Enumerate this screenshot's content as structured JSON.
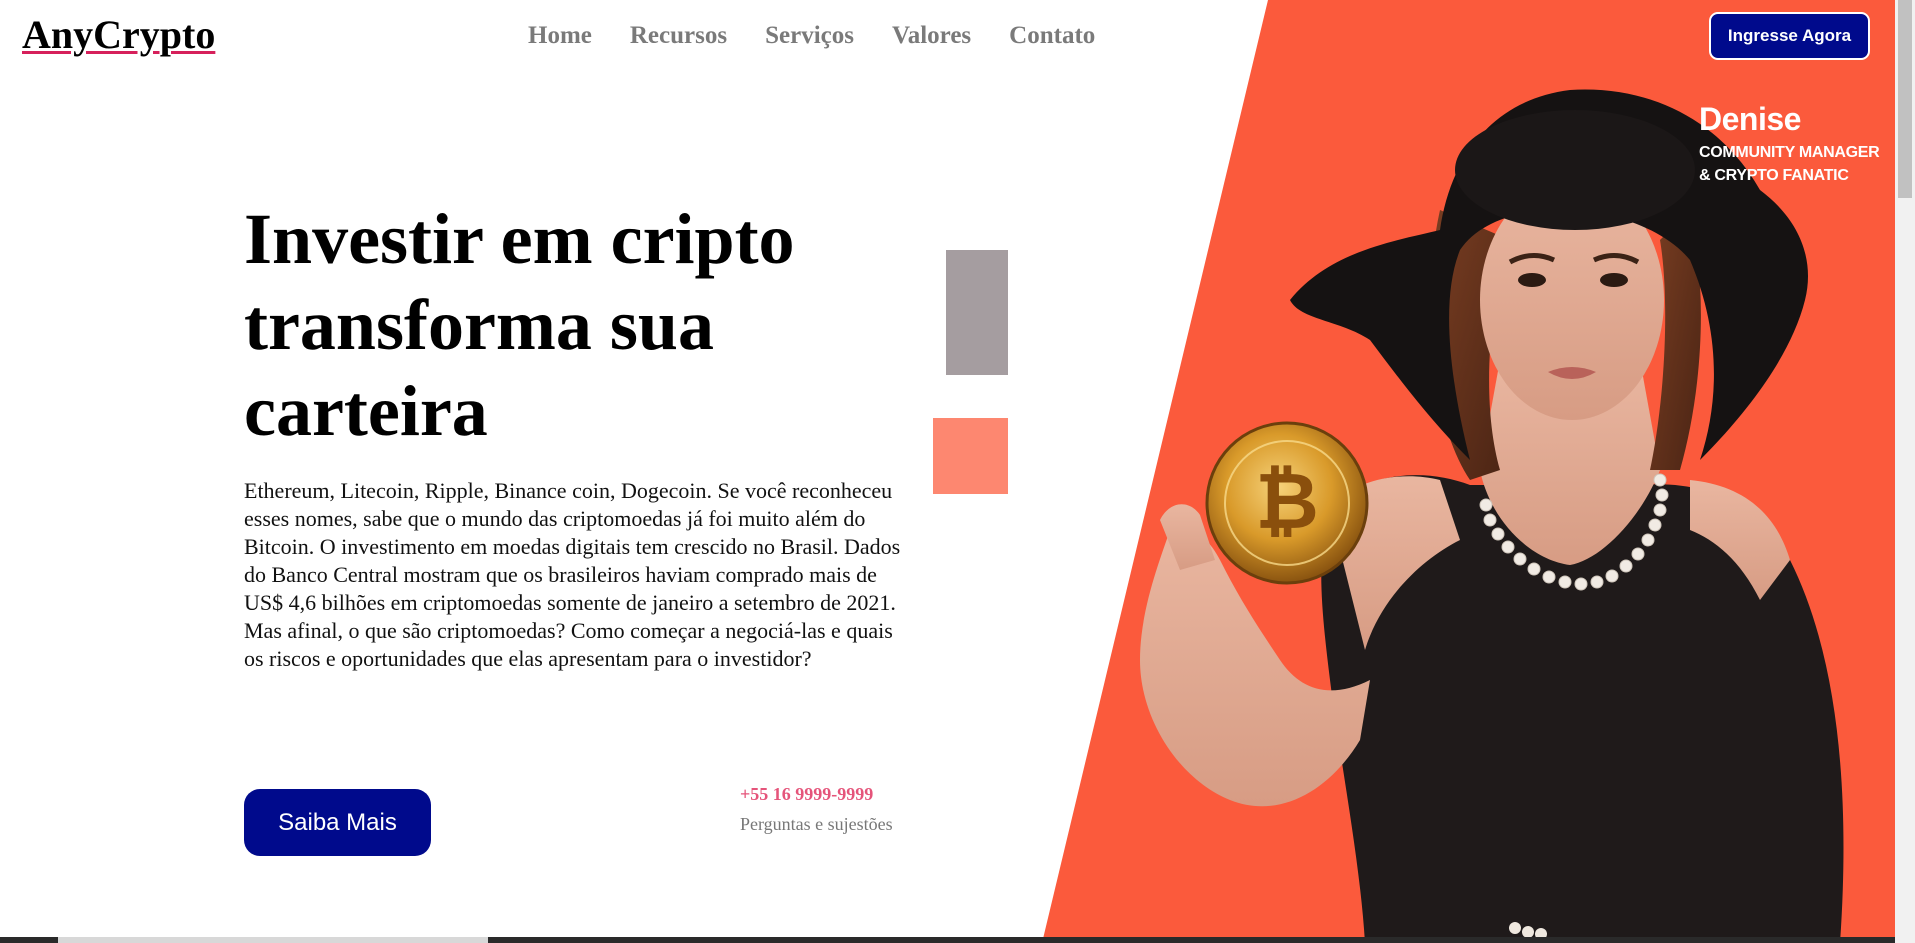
{
  "brand": {
    "logo": "AnyCrypto",
    "accent_underline": "#d6205b"
  },
  "nav": {
    "items": [
      "Home",
      "Recursos",
      "Serviços",
      "Valores",
      "Contato"
    ]
  },
  "header": {
    "join_label": "Ingresse Agora"
  },
  "profile": {
    "name": "Denise",
    "role_line1": "COMMUNITY MANAGER",
    "role_line2": "& CRYPTO FANATIC"
  },
  "hero": {
    "headline": "Investir em cripto transforma sua carteira",
    "body": "Ethereum, Litecoin, Ripple, Binance coin, Dogecoin. Se você reconheceu esses nomes, sabe que o mundo das criptomoedas já foi muito além do Bitcoin. O investimento em moedas digitais tem crescido no Brasil. Dados do Banco Central mostram que os brasileiros haviam comprado mais de US$ 4,6 bilhões em criptomoedas somente de janeiro a setembro de 2021. Mas afinal, o que são criptomoedas? Como começar a negociá-las e quais os riscos e oportunidades que elas apresentam para o investidor?",
    "cta_label": "Saiba Mais",
    "phone": "+55 16 9999-9999",
    "phone_caption": "Perguntas e sujestões"
  },
  "icons": {
    "coin": "bitcoin-coin-icon"
  },
  "colors": {
    "primary": "#000a8c",
    "hero_panel": "#fb5a3c",
    "square_gray": "#a59da0",
    "square_salmon": "#fd8770",
    "phone": "#e5547a"
  }
}
